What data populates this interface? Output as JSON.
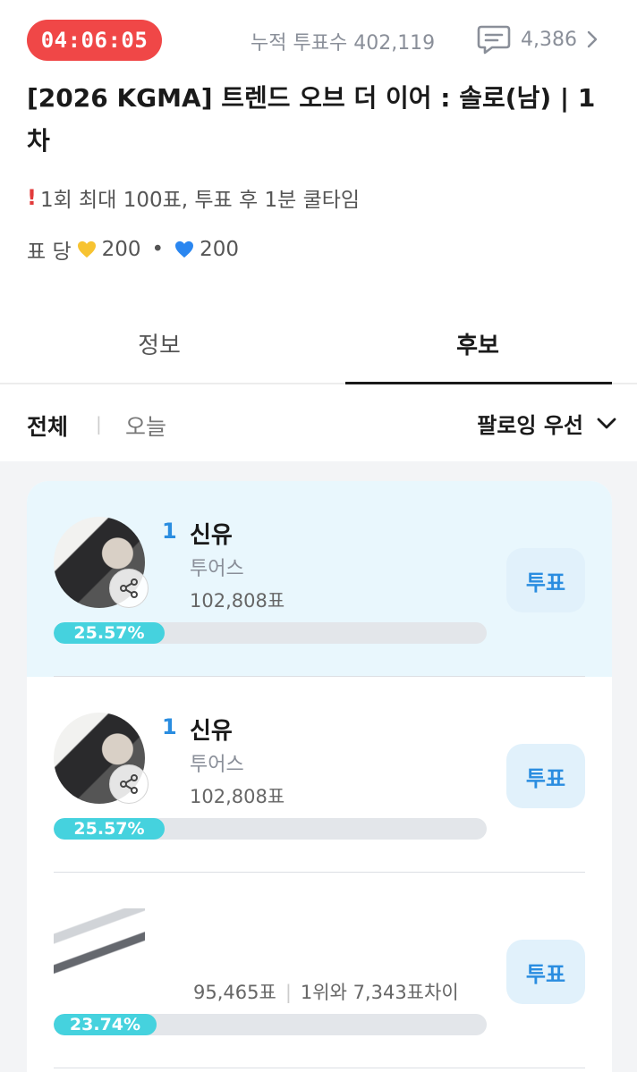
{
  "header": {
    "timer": "04:06:05",
    "total_votes_label": "누적 투표수",
    "total_votes_value": "402,119",
    "comment_count": "4,386",
    "title": "[2026 KGMA] 트렌드 오브 더 이어 : 솔로(남) | 1차",
    "notice": "1회 최대 100표, 투표 후 1분 쿨타임",
    "cost_label": "표 당",
    "cost_yellow": "200",
    "cost_dot": "•",
    "cost_blue": "200",
    "colors": {
      "timer_bg": "#f04747",
      "yellow_heart": "#f7c331",
      "blue_heart": "#2a86f0"
    }
  },
  "tabs": [
    {
      "label": "정보",
      "active": false
    },
    {
      "label": "후보",
      "active": true
    }
  ],
  "filters": {
    "all": "전체",
    "separator": "|",
    "today": "오늘",
    "sort": "팔로잉 우선"
  },
  "candidates": [
    {
      "rank": "1",
      "name": "신유",
      "group": "투어스",
      "votes": "102,808표",
      "gap": "",
      "percent_label": "25.57%",
      "percent": 25.57,
      "vote_label": "투표",
      "highlight": true
    },
    {
      "rank": "1",
      "name": "신유",
      "group": "투어스",
      "votes": "102,808표",
      "gap": "",
      "percent_label": "25.57%",
      "percent": 25.57,
      "vote_label": "투표",
      "highlight": false
    },
    {
      "rank": "",
      "name": "",
      "group": "",
      "votes": "95,465표",
      "gap": "1위와 7,343표차이",
      "percent_label": "23.74%",
      "percent": 23.74,
      "vote_label": "투표",
      "highlight": false
    }
  ],
  "icons": {
    "comment": "comment-icon",
    "chevron": "chevron-right-icon",
    "share": "share-icon",
    "sort": "chevron-down-icon"
  }
}
